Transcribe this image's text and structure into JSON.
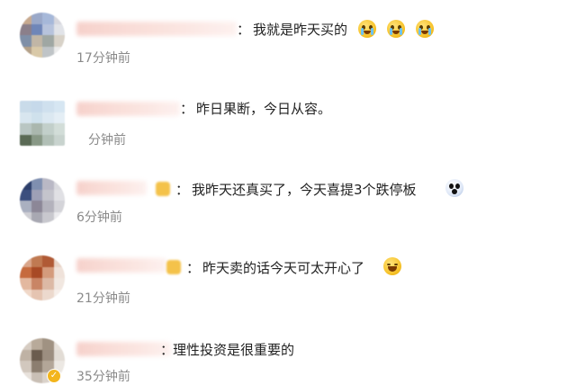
{
  "comments": [
    {
      "text": "我就是昨天买的",
      "time": "17分钟前",
      "emojis": [
        "loudly-crying-emoji",
        "loudly-crying-emoji",
        "loudly-crying-emoji"
      ]
    },
    {
      "text": "昨日果断，今日从容。",
      "time": "分钟前",
      "emojis": []
    },
    {
      "text": "我昨天还真买了，今天喜提3个跌停板",
      "time": "6分钟前",
      "emojis": [
        "scared-face-emoji"
      ]
    },
    {
      "text": "昨天卖的话今天可太开心了",
      "time": "21分钟前",
      "emojis": [
        "laughing-emoji"
      ]
    },
    {
      "text": "理性投资是很重要的",
      "time": "35分钟前",
      "emojis": []
    }
  ],
  "colon": "："
}
